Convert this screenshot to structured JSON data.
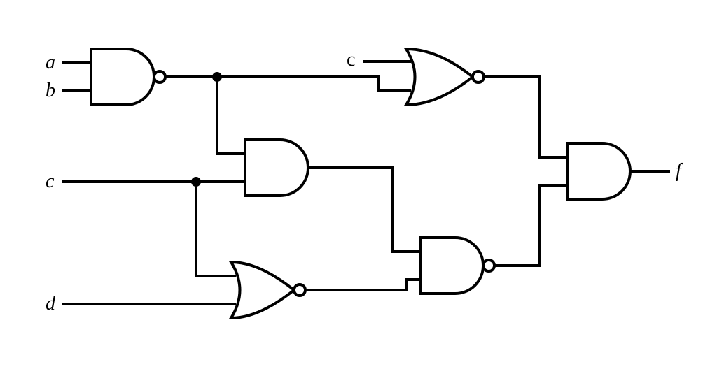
{
  "inputs": {
    "a": "a",
    "b": "b",
    "c": "c",
    "c2": "c",
    "d": "d"
  },
  "output": "f",
  "gates": [
    {
      "id": "g1",
      "type": "NAND",
      "inputs": [
        "a",
        "b"
      ],
      "out": "n1"
    },
    {
      "id": "g2",
      "type": "AND",
      "inputs": [
        "n1",
        "c"
      ],
      "out": "n2"
    },
    {
      "id": "g3",
      "type": "NOR",
      "inputs": [
        "c",
        "d"
      ],
      "out": "n3"
    },
    {
      "id": "g4",
      "type": "NOR",
      "inputs": [
        "c2",
        "n2"
      ],
      "out": "n4"
    },
    {
      "id": "g5",
      "type": "NAND",
      "inputs": [
        "n2",
        "n3"
      ],
      "out": "n5"
    },
    {
      "id": "g6",
      "type": "AND",
      "inputs": [
        "n4",
        "n5"
      ],
      "out": "f"
    }
  ]
}
